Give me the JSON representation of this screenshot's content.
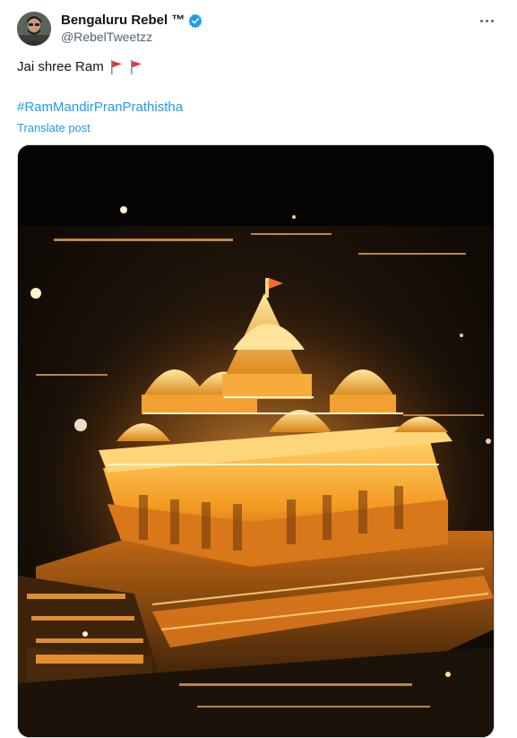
{
  "author": {
    "display_name": "Bengaluru Rebel ™",
    "handle": "@RebelTweetzz",
    "verified": true
  },
  "post": {
    "text": "Jai shree Ram",
    "emojis": [
      "red-triangular-flag",
      "red-triangular-flag"
    ],
    "hashtag": "#RamMandirPranPrathistha",
    "translate_label": "Translate post"
  },
  "media": {
    "type": "image",
    "subject": "illuminated temple at night"
  },
  "colors": {
    "link": "#1d9bf0",
    "text": "#0f1419",
    "secondary_text": "#536471",
    "verified_badge": "#1d9bf0",
    "flag": "#e0363c",
    "temple_glow": "#f5a623"
  }
}
